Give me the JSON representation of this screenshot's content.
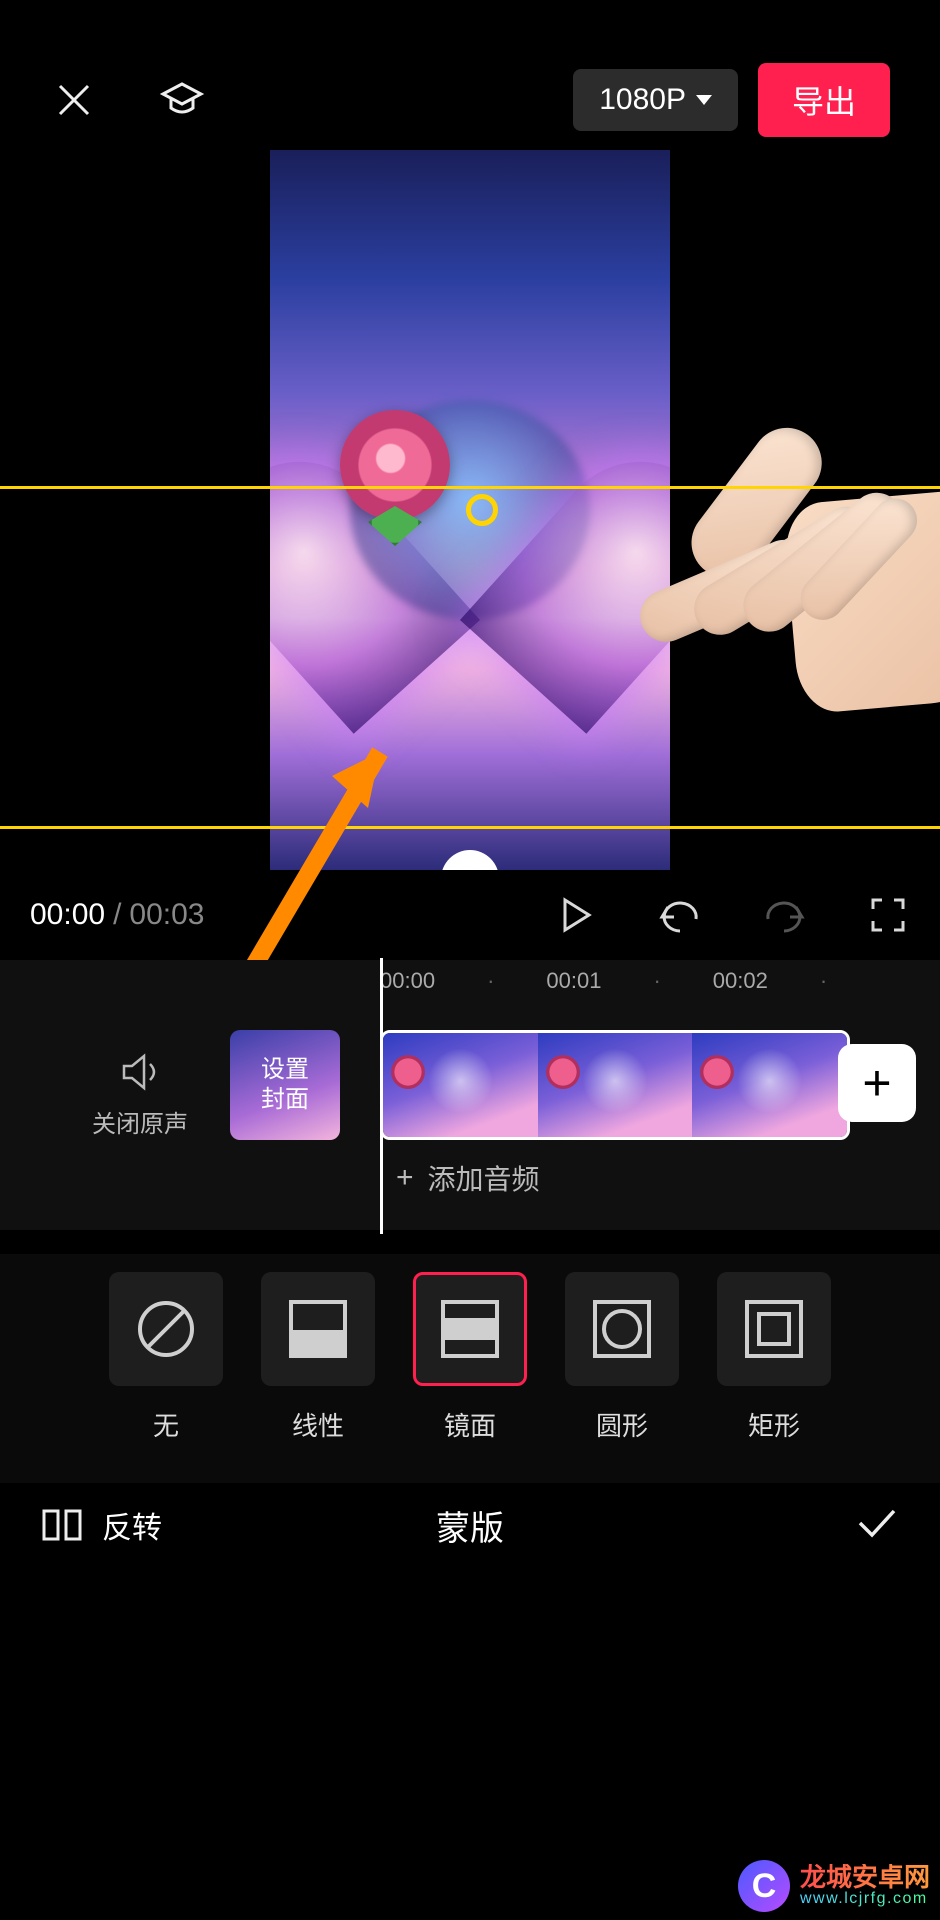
{
  "topbar": {
    "resolution_label": "1080P",
    "export_label": "导出"
  },
  "preview": {
    "anchor_icon": "double-chevron-down"
  },
  "transport": {
    "current_time": "00:00",
    "duration": "00:03"
  },
  "timeline": {
    "ruler": [
      "00:00",
      "·",
      "00:01",
      "·",
      "00:02",
      "·"
    ],
    "mute_label": "关闭原声",
    "set_cover_label": "设置\n封面",
    "add_audio_label": "添加音频"
  },
  "mask_options": [
    {
      "id": "none",
      "label": "无",
      "shape": "none",
      "selected": false
    },
    {
      "id": "linear",
      "label": "线性",
      "shape": "linear",
      "selected": false
    },
    {
      "id": "mirror",
      "label": "镜面",
      "shape": "mirror",
      "selected": true
    },
    {
      "id": "circle",
      "label": "圆形",
      "shape": "circle",
      "selected": false
    },
    {
      "id": "rect",
      "label": "矩形",
      "shape": "rect",
      "selected": false
    }
  ],
  "footer": {
    "flip_label": "反转",
    "panel_title": "蒙版"
  },
  "watermark": {
    "brand": "龙城安卓网",
    "url": "www.lcjrfg.com",
    "badge_letter": "C"
  }
}
